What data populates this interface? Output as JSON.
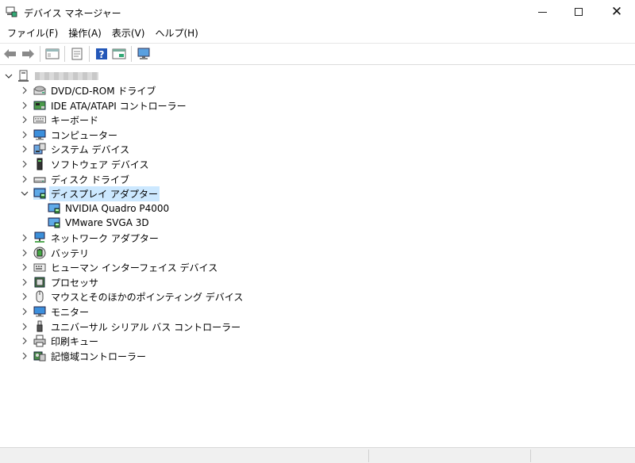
{
  "window": {
    "title": "デバイス マネージャー"
  },
  "menu": [
    "ファイル(F)",
    "操作(A)",
    "表示(V)",
    "ヘルプ(H)"
  ],
  "toolbar": {
    "buttons": [
      "back-arrow-icon",
      "forward-arrow-icon",
      "show-hidden-icon",
      "properties-icon",
      "help-icon",
      "update-driver-icon",
      "scan-hardware-icon"
    ]
  },
  "tree": {
    "categories": [
      {
        "label": "DVD/CD-ROM ドライブ",
        "icon": "dvd-drive-icon"
      },
      {
        "label": "IDE ATA/ATAPI コントローラー",
        "icon": "ide-controller-icon"
      },
      {
        "label": "キーボード",
        "icon": "keyboard-icon"
      },
      {
        "label": "コンピューター",
        "icon": "computer-icon"
      },
      {
        "label": "システム デバイス",
        "icon": "system-devices-icon"
      },
      {
        "label": "ソフトウェア デバイス",
        "icon": "software-device-icon"
      },
      {
        "label": "ディスク ドライブ",
        "icon": "disk-drive-icon"
      },
      {
        "label": "ディスプレイ アダプター",
        "icon": "display-adapter-icon",
        "expanded": true,
        "children": [
          {
            "label": "NVIDIA Quadro P4000",
            "icon": "display-adapter-icon"
          },
          {
            "label": "VMware SVGA 3D",
            "icon": "display-adapter-icon"
          }
        ]
      },
      {
        "label": "ネットワーク アダプター",
        "icon": "network-adapter-icon"
      },
      {
        "label": "バッテリ",
        "icon": "battery-icon"
      },
      {
        "label": "ヒューマン インターフェイス デバイス",
        "icon": "hid-icon"
      },
      {
        "label": "プロセッサ",
        "icon": "processor-icon"
      },
      {
        "label": "マウスとそのほかのポインティング デバイス",
        "icon": "mouse-icon"
      },
      {
        "label": "モニター",
        "icon": "monitor-icon"
      },
      {
        "label": "ユニバーサル シリアル バス コントローラー",
        "icon": "usb-icon"
      },
      {
        "label": "印刷キュー",
        "icon": "printer-icon"
      },
      {
        "label": "記憶域コントローラー",
        "icon": "storage-controller-icon"
      }
    ]
  },
  "colors": {
    "selection": "#cce8ff"
  }
}
